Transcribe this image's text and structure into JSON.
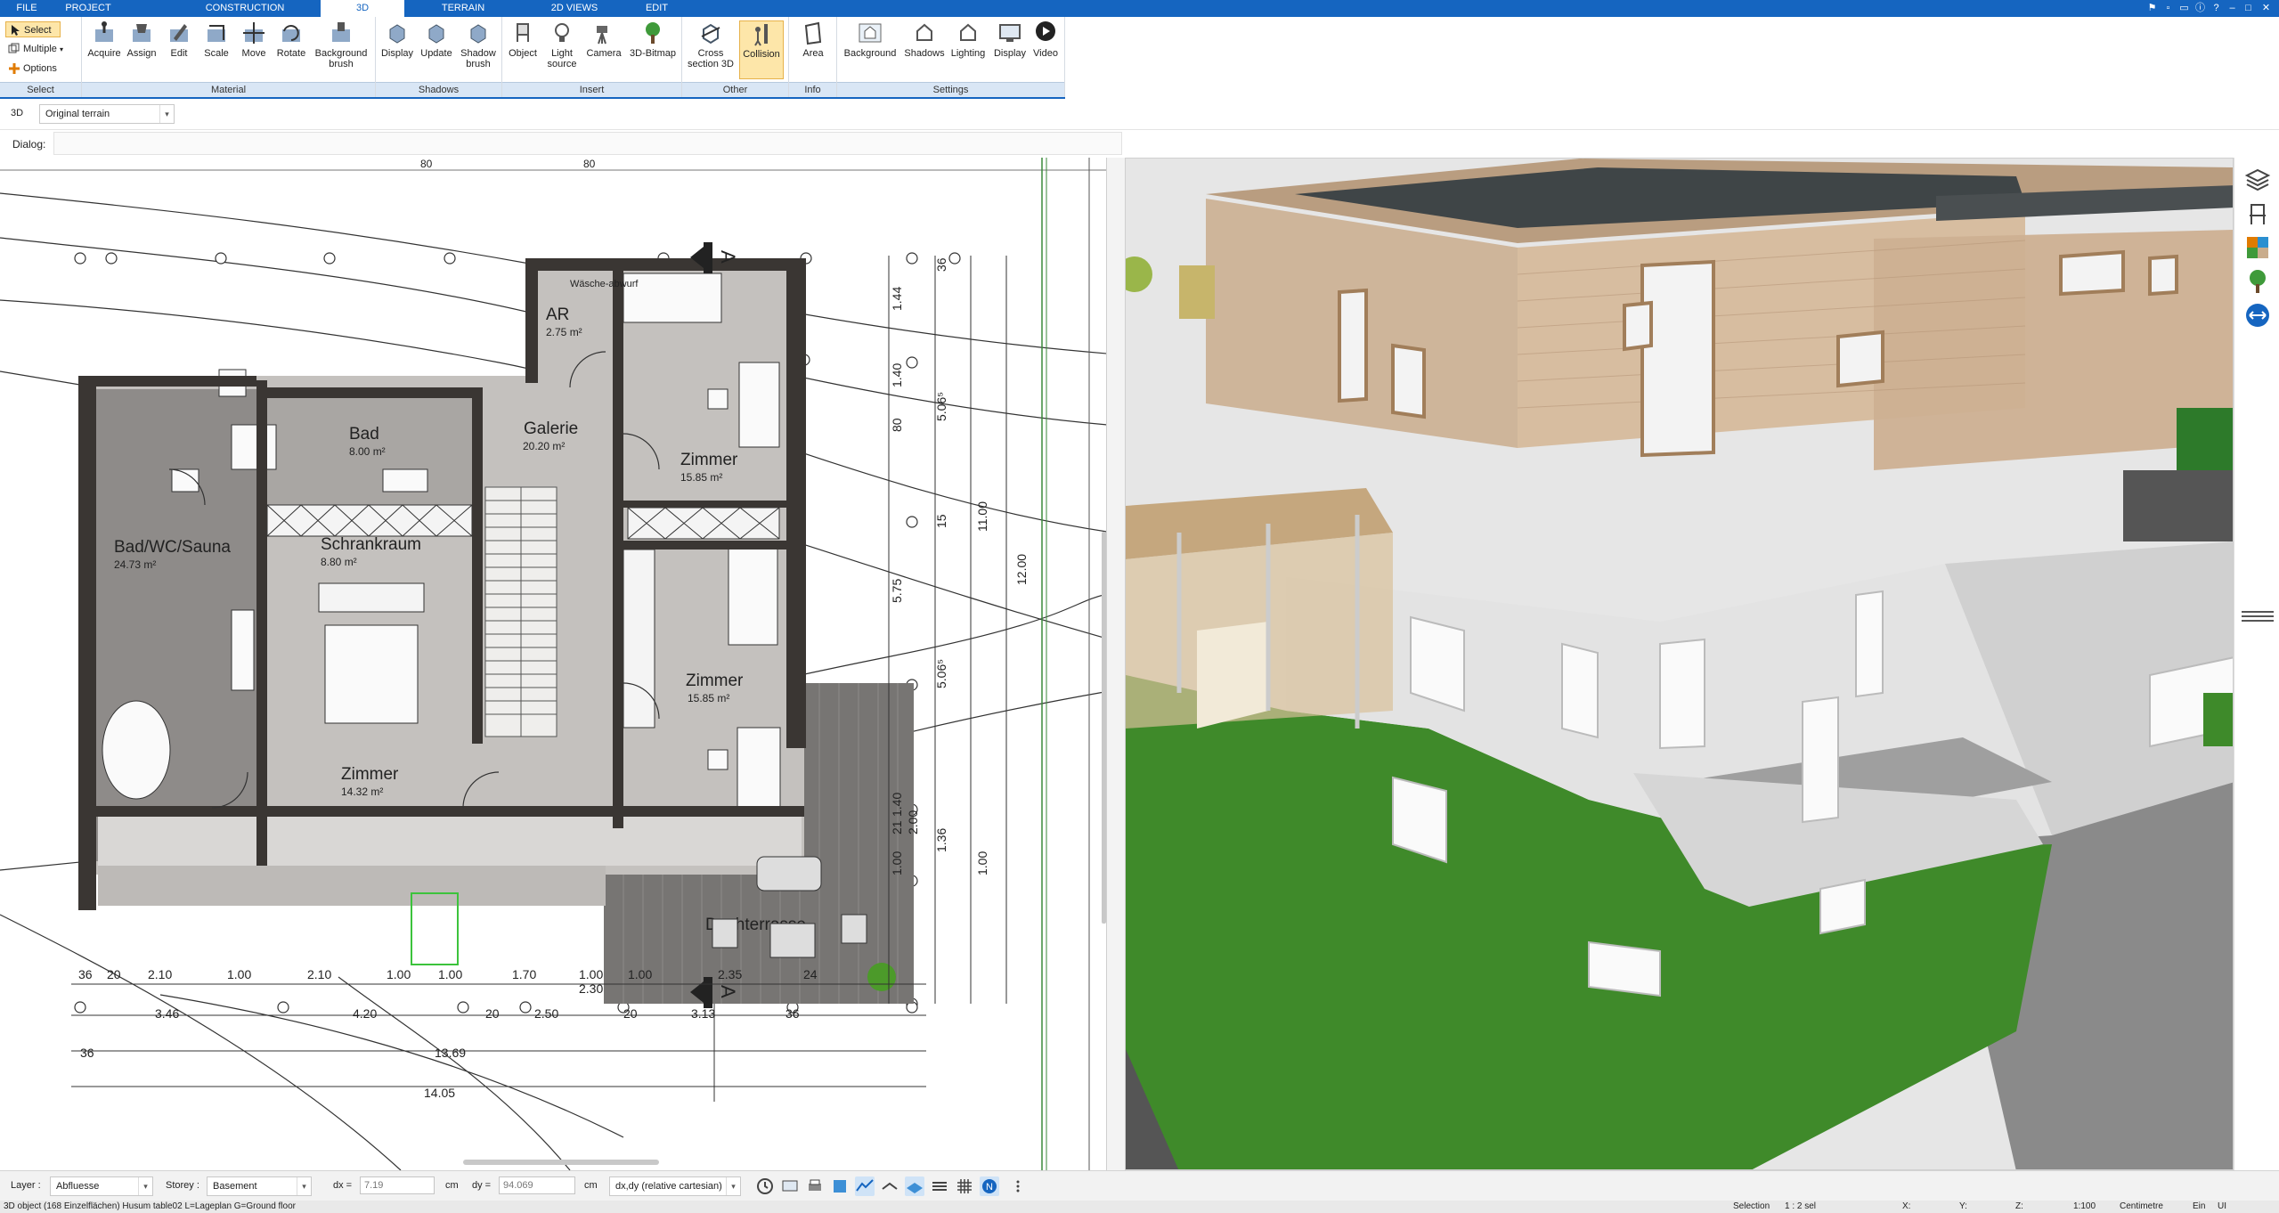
{
  "menu_tabs": [
    {
      "label": "FILE",
      "active": false
    },
    {
      "label": "PROJECT",
      "active": false
    },
    {
      "label": "CONSTRUCTION",
      "active": false
    },
    {
      "label": "3D",
      "active": true
    },
    {
      "label": "TERRAIN",
      "active": false
    },
    {
      "label": "2D VIEWS",
      "active": false
    },
    {
      "label": "EDIT",
      "active": false
    }
  ],
  "ribbon": {
    "select_group": {
      "select": "Select",
      "multiple": "Multiple",
      "options": "Options",
      "footer": "Select"
    },
    "material_group": {
      "buttons": [
        "Acquire",
        "Assign",
        "Edit",
        "Scale",
        "Move",
        "Rotate",
        "Background brush"
      ],
      "footer": "Material"
    },
    "shadows_group": {
      "buttons": [
        "Display",
        "Update",
        "Shadow brush"
      ],
      "footer": "Shadows"
    },
    "insert_group": {
      "buttons": [
        "Object",
        "Light source",
        "Camera",
        "3D-Bitmap"
      ],
      "footer": "Insert"
    },
    "other_group": {
      "buttons": [
        "Cross section 3D",
        "Collision"
      ],
      "footer": "Other"
    },
    "info_group": {
      "buttons": [
        "Area"
      ],
      "footer": "Info"
    },
    "settings_group": {
      "buttons": [
        "Background",
        "Shadows",
        "Lighting",
        "Display",
        "Video"
      ],
      "footer": "Settings"
    }
  },
  "toolbar2": {
    "view_mode": "3D",
    "terrain_select": "Original terrain"
  },
  "dialog_label": "Dialog:",
  "plan": {
    "top_ruler": [
      "80",
      "80"
    ],
    "rooms": [
      {
        "name": "AR",
        "area": "2.75 m²"
      },
      {
        "name": "Wäsche-abwurf",
        "area": ""
      },
      {
        "name": "Bad",
        "area": "8.00 m²"
      },
      {
        "name": "Galerie",
        "area": "20.20 m²"
      },
      {
        "name": "Zimmer",
        "area": "15.85 m²"
      },
      {
        "name": "Bad/WC/Sauna",
        "area": "24.73 m²"
      },
      {
        "name": "Schrankraum",
        "area": "8.80 m²"
      },
      {
        "name": "Zimmer",
        "area": "15.85 m²"
      },
      {
        "name": "Zimmer",
        "area": "14.32 m²"
      },
      {
        "name": "Dachterrasse",
        "area": ""
      }
    ],
    "section_marks": [
      "A",
      "A"
    ],
    "dims_bottom_row1": [
      "36",
      "20",
      "2.10",
      "1.00",
      "2.10",
      "1.00",
      "1.00",
      "1.70",
      "1.00",
      "1.00",
      "2.35",
      "24"
    ],
    "dims_bottom_row2": [
      "3.46",
      "4.20",
      "20",
      "2.50",
      "20",
      "3.13",
      "36",
      "2.30"
    ],
    "dims_bottom_row3": [
      "36",
      "13.69"
    ],
    "dims_bottom_row4": [
      "14.05"
    ],
    "dims_right_col1": [
      "36",
      "1.44",
      "1.40",
      "80",
      "15",
      "1.40",
      "21",
      "1.36"
    ],
    "dims_right_col2": [
      "5.06⁵",
      "5.75",
      "5.06⁵",
      "2.00",
      "1.00"
    ],
    "dims_right_col3": [
      "11.00",
      "1.00"
    ],
    "dims_right_col4": [
      "12.00"
    ]
  },
  "bottombar": {
    "layer_label": "Layer :",
    "layer_value": "Abfluesse",
    "storey_label": "Storey :",
    "storey_value": "Basement",
    "dx_label": "dx =",
    "dx_value": "7.19",
    "dx_unit": "cm",
    "dy_label": "dy =",
    "dy_value": "94.069",
    "dy_unit": "cm",
    "coord_mode": "dx,dy (relative cartesian)"
  },
  "statusbar": {
    "message": "3D object (168 Einzelflächen) Husum table02 L=Lageplan G=Ground floor",
    "selection": "Selection",
    "sel_count": "1 : 2 sel",
    "x": "X:",
    "y": "Y:",
    "z": "Z:",
    "scale": "1:100",
    "unit": "Centimetre",
    "mode": "Ein",
    "ui": "UI"
  },
  "colors": {
    "accent_blue": "#1565c0",
    "ribbon_footer": "#d9e6f5",
    "active_button": "#fde6a9",
    "wall": "#3a3633",
    "floor_grey": "#bfbcb9",
    "grass": "#3f8a2a",
    "wood": "#c9ac8c"
  }
}
